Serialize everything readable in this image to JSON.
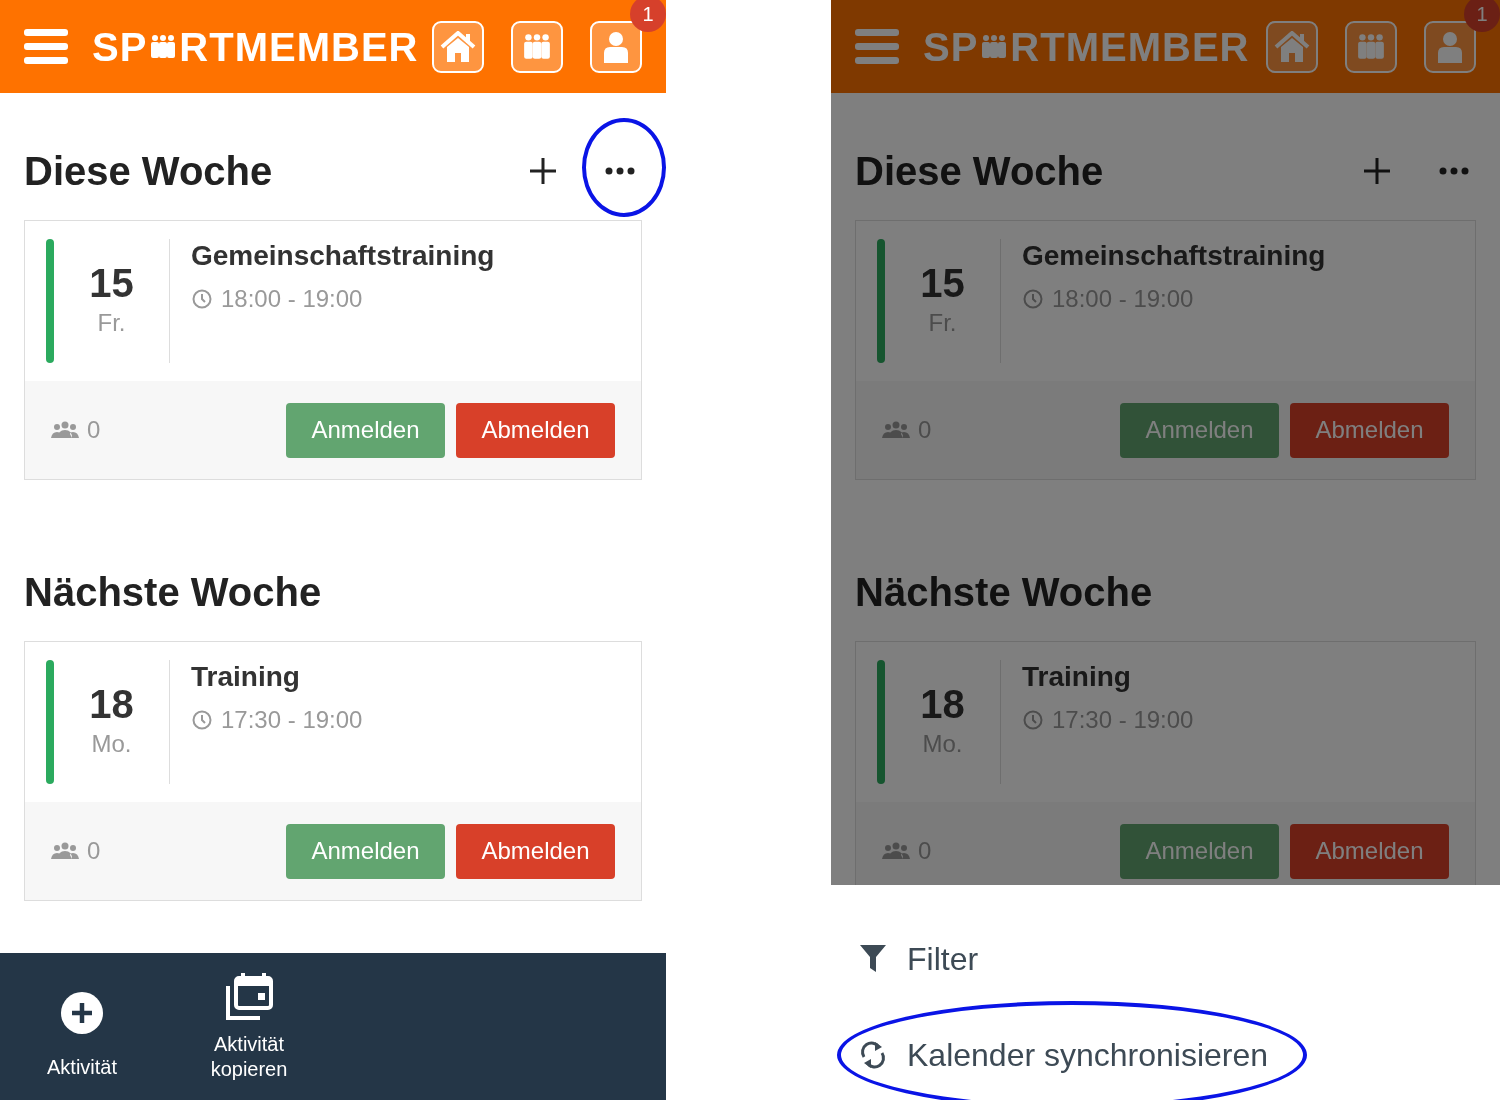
{
  "screens": [
    {
      "kind": "main",
      "header": {
        "logo_start": "SP",
        "logo_end": "RTMEMBER",
        "badge": "1"
      },
      "sections": [
        {
          "title": "Diese Woche",
          "has_actions": true,
          "more_highlighted": true,
          "events": [
            {
              "day": "15",
              "weekday": "Fr.",
              "title": "Gemeinschaftstraining",
              "time": "18:00 - 19:00",
              "color": "#2baa5e",
              "count": "0",
              "buttons": [
                "Anmelden",
                "Abmelden"
              ]
            }
          ]
        },
        {
          "title": "Nächste Woche",
          "has_actions": false,
          "events": [
            {
              "day": "18",
              "weekday": "Mo.",
              "title": "Training",
              "time": "17:30 - 19:00",
              "color": "#2baa5e",
              "count": "0",
              "buttons": [
                "Anmelden",
                "Abmelden"
              ]
            }
          ]
        }
      ],
      "bottom_bar": [
        {
          "kind": "add",
          "label": "Aktivität"
        },
        {
          "kind": "copy",
          "label": "Aktivität kopieren"
        }
      ]
    },
    {
      "kind": "menu",
      "header": {
        "logo_start": "SP",
        "logo_end": "RTMEMBER",
        "badge": "1"
      },
      "sections": [
        {
          "title": "Diese Woche",
          "has_actions": true,
          "more_highlighted": false,
          "events": [
            {
              "day": "15",
              "weekday": "Fr.",
              "title": "Gemeinschaftstraining",
              "time": "18:00 - 19:00",
              "color": "#16552f",
              "count": "0",
              "buttons": [
                "Anmelden",
                "Abmelden"
              ]
            }
          ]
        },
        {
          "title": "Nächste Woche",
          "has_actions": false,
          "events": [
            {
              "day": "18",
              "weekday": "Mo.",
              "title": "Training",
              "time": "17:30 - 19:00",
              "color": "#16552f",
              "count": "0",
              "buttons": [
                "Anmelden",
                "Abmelden"
              ]
            }
          ]
        }
      ],
      "action_sheet": [
        {
          "kind": "filter",
          "label": "Filter",
          "highlighted": false
        },
        {
          "kind": "sync",
          "label": "Kalender synchronisieren",
          "highlighted": true
        }
      ]
    }
  ]
}
